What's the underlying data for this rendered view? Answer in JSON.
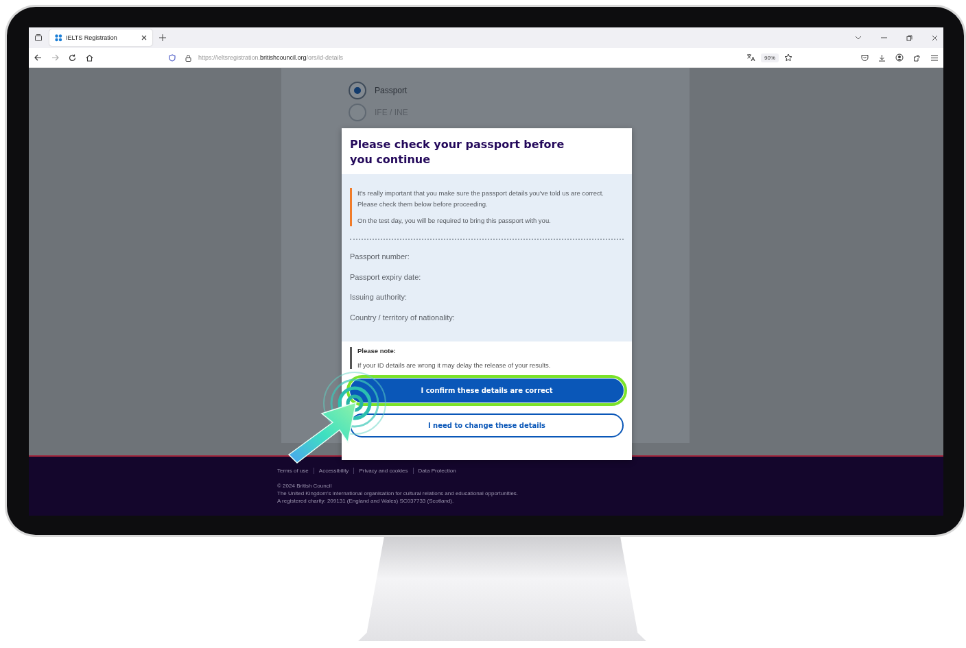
{
  "browser": {
    "tab": {
      "title": "IELTS Registration"
    },
    "url": "https://ieltsregistration.**britishcouncil.org**/ors/id-details",
    "zoom": "90%"
  },
  "id_options": [
    {
      "label": "Passport",
      "selected": true
    },
    {
      "label": "IFE / INE",
      "selected": false
    }
  ],
  "modal": {
    "title": "Please check your passport before you continue",
    "notice": [
      "It's really important that you make sure the passport details you've told us are correct. Please check them below before proceeding.",
      "On the test day, you will be required to bring this passport with you."
    ],
    "fields": [
      {
        "label": "Passport number:"
      },
      {
        "label": "Passport expiry date:"
      },
      {
        "label": "Issuing authority:"
      },
      {
        "label": "Country / territory of nationality:"
      }
    ],
    "note": {
      "heading": "Please note:",
      "text": "If your ID details are wrong it may delay the release of your results."
    },
    "buttons": [
      {
        "label": "I confirm these details are correct",
        "kind": "primary",
        "highlighted": true
      },
      {
        "label": "I need to change these details",
        "kind": "secondary",
        "highlighted": false
      }
    ]
  },
  "footer": {
    "links": [
      "Terms of use",
      "Accessibility",
      "Privacy and cookies",
      "Data Protection"
    ],
    "lines": [
      "© 2024 British Council",
      "The United Kingdom's international organisation for cultural relations and educational opportunities.",
      "A registered charity: 209131 (England and Wales) SC037733 (Scotland)."
    ]
  }
}
